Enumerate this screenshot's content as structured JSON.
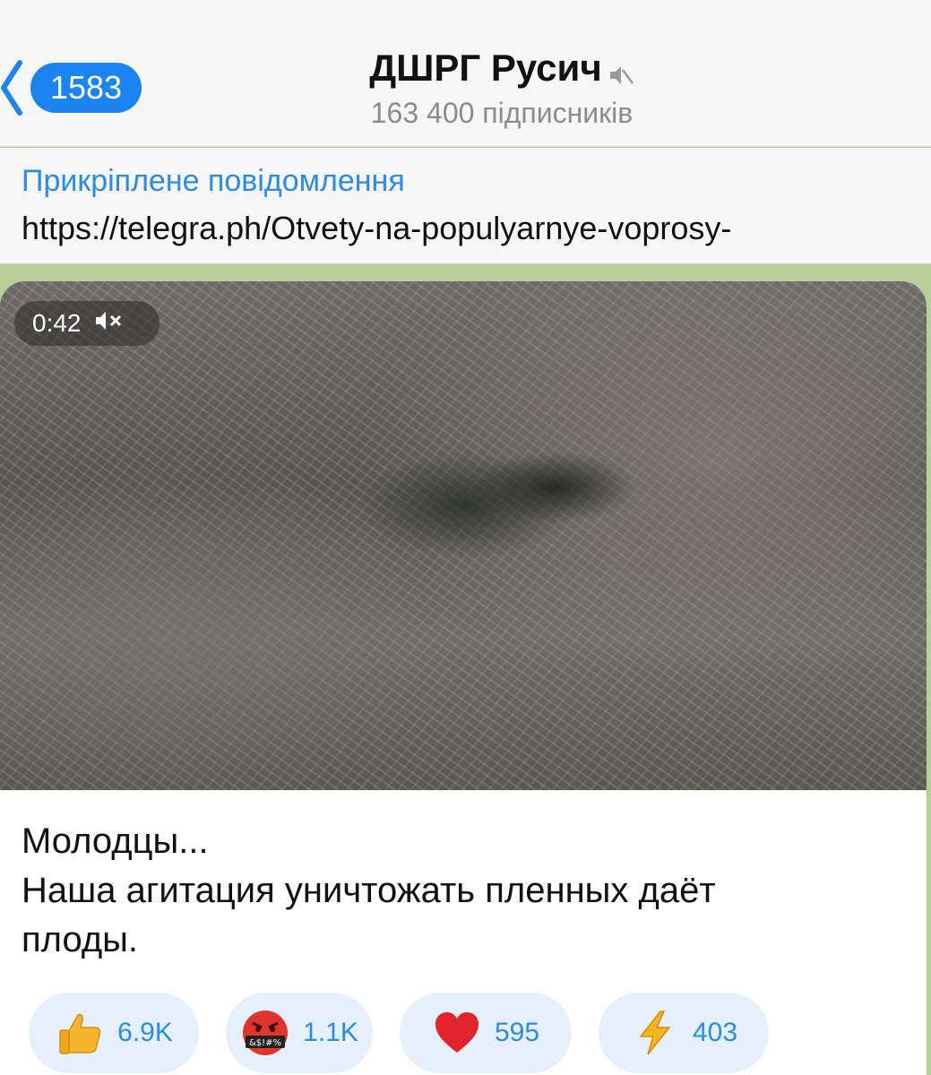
{
  "header": {
    "back_count": "1583",
    "channel_name": "ДШРГ Русич",
    "subscribers": "163 400 підписників"
  },
  "pinned": {
    "title": "Прикріплене повідомлення",
    "text": "https://telegra.ph/Otvety-na-populyarnye-voprosy-"
  },
  "message": {
    "video_duration": "0:42",
    "caption_lines": [
      "Молодцы...",
      "Наша агитация уничтожать пленных даёт",
      "плоды."
    ],
    "reactions": [
      {
        "emoji": "thumbs-up",
        "count": "6.9K"
      },
      {
        "emoji": "swearing-face",
        "count": "1.1K"
      },
      {
        "emoji": "red-heart",
        "count": "595"
      },
      {
        "emoji": "high-voltage",
        "count": "403"
      }
    ]
  },
  "colors": {
    "accent": "#1b84f0",
    "link": "#2a8be8",
    "reaction_bg": "#e6f0fb",
    "chat_bg": "#b9cf9a"
  }
}
